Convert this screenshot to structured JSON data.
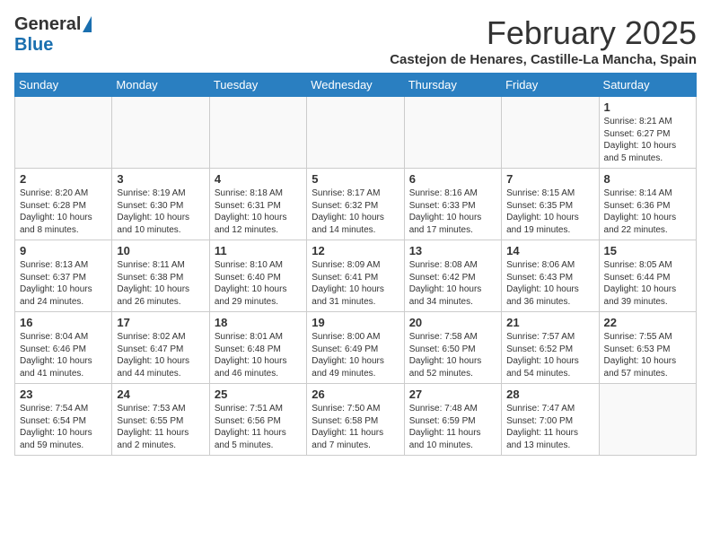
{
  "header": {
    "logo_general": "General",
    "logo_blue": "Blue",
    "month_title": "February 2025",
    "subtitle": "Castejon de Henares, Castille-La Mancha, Spain"
  },
  "days_of_week": [
    "Sunday",
    "Monday",
    "Tuesday",
    "Wednesday",
    "Thursday",
    "Friday",
    "Saturday"
  ],
  "weeks": [
    [
      {
        "day": "",
        "info": ""
      },
      {
        "day": "",
        "info": ""
      },
      {
        "day": "",
        "info": ""
      },
      {
        "day": "",
        "info": ""
      },
      {
        "day": "",
        "info": ""
      },
      {
        "day": "",
        "info": ""
      },
      {
        "day": "1",
        "info": "Sunrise: 8:21 AM\nSunset: 6:27 PM\nDaylight: 10 hours\nand 5 minutes."
      }
    ],
    [
      {
        "day": "2",
        "info": "Sunrise: 8:20 AM\nSunset: 6:28 PM\nDaylight: 10 hours\nand 8 minutes."
      },
      {
        "day": "3",
        "info": "Sunrise: 8:19 AM\nSunset: 6:30 PM\nDaylight: 10 hours\nand 10 minutes."
      },
      {
        "day": "4",
        "info": "Sunrise: 8:18 AM\nSunset: 6:31 PM\nDaylight: 10 hours\nand 12 minutes."
      },
      {
        "day": "5",
        "info": "Sunrise: 8:17 AM\nSunset: 6:32 PM\nDaylight: 10 hours\nand 14 minutes."
      },
      {
        "day": "6",
        "info": "Sunrise: 8:16 AM\nSunset: 6:33 PM\nDaylight: 10 hours\nand 17 minutes."
      },
      {
        "day": "7",
        "info": "Sunrise: 8:15 AM\nSunset: 6:35 PM\nDaylight: 10 hours\nand 19 minutes."
      },
      {
        "day": "8",
        "info": "Sunrise: 8:14 AM\nSunset: 6:36 PM\nDaylight: 10 hours\nand 22 minutes."
      }
    ],
    [
      {
        "day": "9",
        "info": "Sunrise: 8:13 AM\nSunset: 6:37 PM\nDaylight: 10 hours\nand 24 minutes."
      },
      {
        "day": "10",
        "info": "Sunrise: 8:11 AM\nSunset: 6:38 PM\nDaylight: 10 hours\nand 26 minutes."
      },
      {
        "day": "11",
        "info": "Sunrise: 8:10 AM\nSunset: 6:40 PM\nDaylight: 10 hours\nand 29 minutes."
      },
      {
        "day": "12",
        "info": "Sunrise: 8:09 AM\nSunset: 6:41 PM\nDaylight: 10 hours\nand 31 minutes."
      },
      {
        "day": "13",
        "info": "Sunrise: 8:08 AM\nSunset: 6:42 PM\nDaylight: 10 hours\nand 34 minutes."
      },
      {
        "day": "14",
        "info": "Sunrise: 8:06 AM\nSunset: 6:43 PM\nDaylight: 10 hours\nand 36 minutes."
      },
      {
        "day": "15",
        "info": "Sunrise: 8:05 AM\nSunset: 6:44 PM\nDaylight: 10 hours\nand 39 minutes."
      }
    ],
    [
      {
        "day": "16",
        "info": "Sunrise: 8:04 AM\nSunset: 6:46 PM\nDaylight: 10 hours\nand 41 minutes."
      },
      {
        "day": "17",
        "info": "Sunrise: 8:02 AM\nSunset: 6:47 PM\nDaylight: 10 hours\nand 44 minutes."
      },
      {
        "day": "18",
        "info": "Sunrise: 8:01 AM\nSunset: 6:48 PM\nDaylight: 10 hours\nand 46 minutes."
      },
      {
        "day": "19",
        "info": "Sunrise: 8:00 AM\nSunset: 6:49 PM\nDaylight: 10 hours\nand 49 minutes."
      },
      {
        "day": "20",
        "info": "Sunrise: 7:58 AM\nSunset: 6:50 PM\nDaylight: 10 hours\nand 52 minutes."
      },
      {
        "day": "21",
        "info": "Sunrise: 7:57 AM\nSunset: 6:52 PM\nDaylight: 10 hours\nand 54 minutes."
      },
      {
        "day": "22",
        "info": "Sunrise: 7:55 AM\nSunset: 6:53 PM\nDaylight: 10 hours\nand 57 minutes."
      }
    ],
    [
      {
        "day": "23",
        "info": "Sunrise: 7:54 AM\nSunset: 6:54 PM\nDaylight: 10 hours\nand 59 minutes."
      },
      {
        "day": "24",
        "info": "Sunrise: 7:53 AM\nSunset: 6:55 PM\nDaylight: 11 hours\nand 2 minutes."
      },
      {
        "day": "25",
        "info": "Sunrise: 7:51 AM\nSunset: 6:56 PM\nDaylight: 11 hours\nand 5 minutes."
      },
      {
        "day": "26",
        "info": "Sunrise: 7:50 AM\nSunset: 6:58 PM\nDaylight: 11 hours\nand 7 minutes."
      },
      {
        "day": "27",
        "info": "Sunrise: 7:48 AM\nSunset: 6:59 PM\nDaylight: 11 hours\nand 10 minutes."
      },
      {
        "day": "28",
        "info": "Sunrise: 7:47 AM\nSunset: 7:00 PM\nDaylight: 11 hours\nand 13 minutes."
      },
      {
        "day": "",
        "info": ""
      }
    ]
  ]
}
